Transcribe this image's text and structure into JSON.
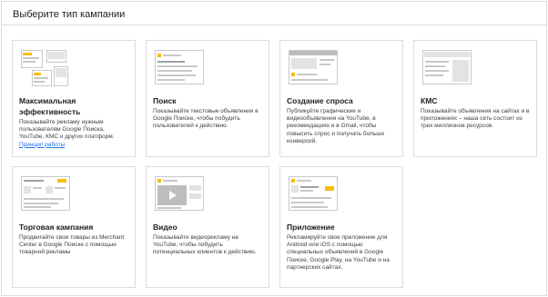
{
  "panel": {
    "title": "Выберите тип кампании"
  },
  "cards": [
    {
      "key": "max",
      "title": "Максимальная эффективность",
      "desc": "Показывайте рекламу нужным пользователям Google Поиска, YouTube, КМС и других платформ.",
      "link": "Принцип работы",
      "icon": "performance-max-illustration"
    },
    {
      "key": "search",
      "title": "Поиск",
      "desc": "Показывайте текстовые объявления в Google Поиске, чтобы побудить пользователей к действию.",
      "icon": "search-ad-illustration"
    },
    {
      "key": "demand",
      "title": "Создание спроса",
      "desc": "Публикуйте графические и видеообъявления на YouTube, в рекомендациях и в Gmail, чтобы повысить спрос и получать больше конверсий.",
      "icon": "demand-gen-illustration"
    },
    {
      "key": "display",
      "title": "КМС",
      "desc": "Показывайте объявления на сайтах и в приложениях – наша сеть состоит из трех миллионов ресурсов.",
      "icon": "display-network-illustration"
    },
    {
      "key": "shopping",
      "title": "Торговая кампания",
      "desc": "Продвигайте свои товары из Merchant Center в Google Поиске с помощью товарной рекламы",
      "icon": "shopping-illustration"
    },
    {
      "key": "video",
      "title": "Видео",
      "desc": "Показывайте видеорекламу на YouTube, чтобы побудить потенциальных клиентов к действию.",
      "icon": "video-illustration"
    },
    {
      "key": "app",
      "title": "Приложение",
      "desc": "Рекламируйте свое приложение для Android или iOS с помощью специальных объявлений в Google Поиске, Google Play, на YouTube и на партнерских сайтах.",
      "icon": "app-illustration"
    }
  ],
  "colors": {
    "accent_yellow": "#fbbc04",
    "link_blue": "#1a73e8",
    "border": "#dadce0"
  }
}
